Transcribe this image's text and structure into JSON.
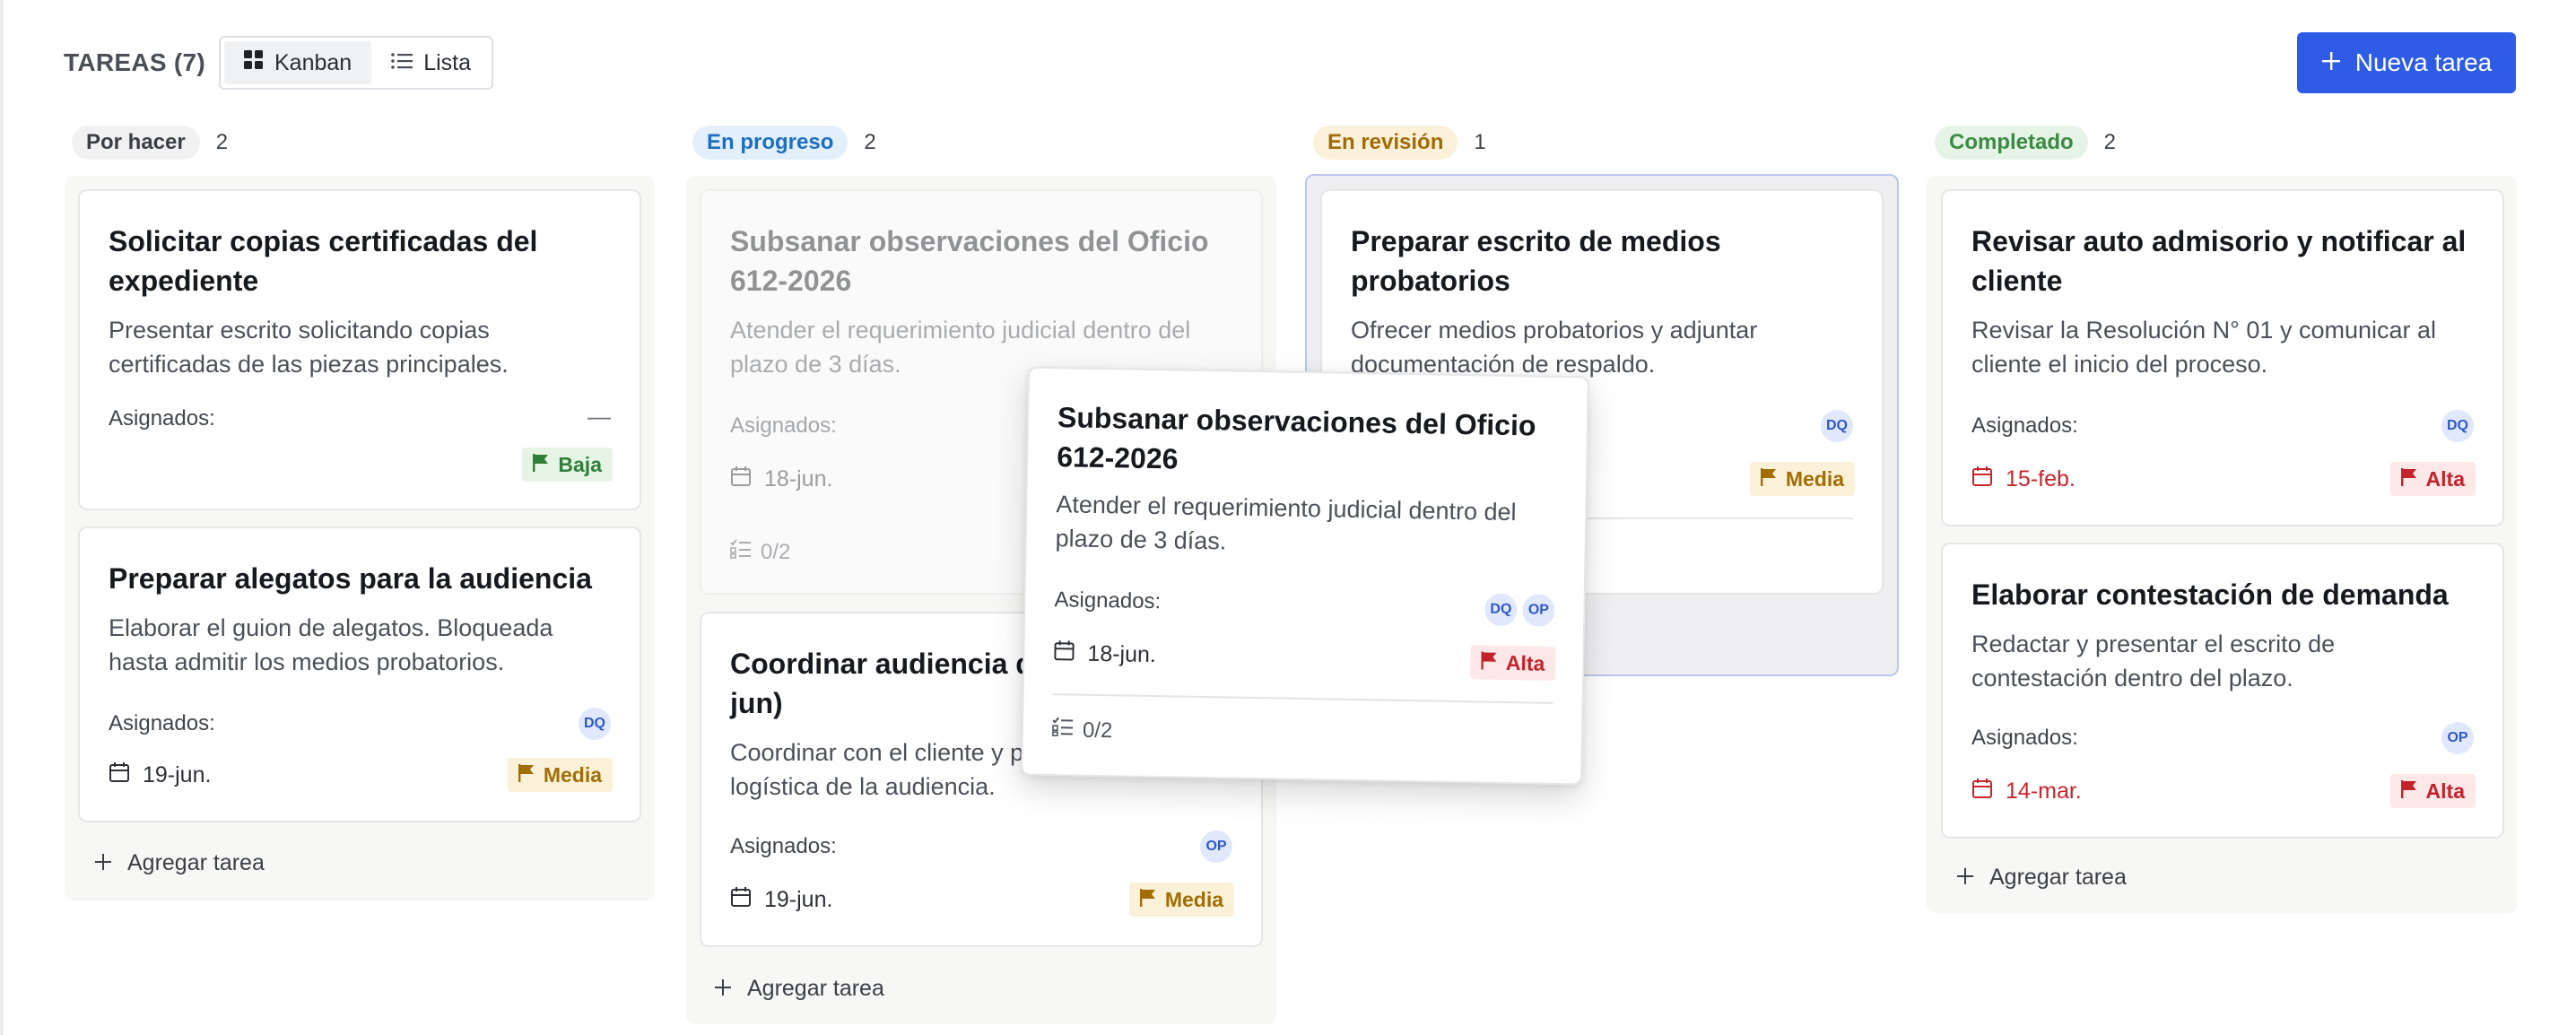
{
  "header": {
    "title": "TAREAS (7)",
    "views": [
      {
        "label": "Kanban",
        "icon": "grid-icon",
        "active": true
      },
      {
        "label": "Lista",
        "icon": "list-icon",
        "active": false
      }
    ],
    "new_task_label": "Nueva tarea"
  },
  "columns": [
    {
      "name": "Por hacer",
      "count": "2",
      "add_label": "Agregar tarea",
      "cards": [
        {
          "title": "Solicitar copias certificadas del expediente",
          "desc": "Presentar escrito solicitando copias certificadas de las piezas principales.",
          "assigned_label": "Asignados:",
          "assignee_placeholder": "—",
          "priority": "Baja"
        },
        {
          "title": "Preparar alegatos para la audiencia",
          "desc": "Elaborar el guion de alegatos. Bloqueada hasta admitir los medios probatorios.",
          "assigned_label": "Asignados:",
          "assignees": [
            "DQ"
          ],
          "date": "19-jun.",
          "priority": "Media"
        }
      ]
    },
    {
      "name": "En progreso",
      "count": "2",
      "add_label": "Agregar tarea",
      "cards": [
        {
          "title": "Subsanar observaciones del Oficio 612-2026",
          "desc": "Atender el requerimiento judicial dentro del plazo de 3 días.",
          "assigned_label": "Asignados:",
          "date": "18-jun.",
          "checklist": "0/2"
        },
        {
          "title": "Coordinar audiencia de",
          "title_line2": "jun)",
          "desc_line1": "Coordinar con el cliente y p",
          "desc_line2": "logística de la audiencia.",
          "assigned_label": "Asignados:",
          "assignees": [
            "OP"
          ],
          "date": "19-jun.",
          "priority": "Media"
        }
      ]
    },
    {
      "name": "En revisión",
      "count": "1",
      "cards": [
        {
          "title": "Preparar escrito de medios probatorios",
          "desc": "Ofrecer medios probatorios y adjuntar documentación de respaldo.",
          "assignees": [
            "DQ"
          ],
          "priority": "Media"
        }
      ]
    },
    {
      "name": "Completado",
      "count": "2",
      "add_label": "Agregar tarea",
      "cards": [
        {
          "title": "Revisar auto admisorio y notificar al cliente",
          "desc": "Revisar la Resolución N° 01 y comunicar al cliente el inicio del proceso.",
          "assigned_label": "Asignados:",
          "assignees": [
            "DQ"
          ],
          "date": "15-feb.",
          "priority": "Alta"
        },
        {
          "title": "Elaborar contestación de demanda",
          "desc": "Redactar y presentar el escrito de contestación dentro del plazo.",
          "assigned_label": "Asignados:",
          "assignees": [
            "OP"
          ],
          "date": "14-mar.",
          "priority": "Alta"
        }
      ]
    }
  ],
  "dragging_card": {
    "title": "Subsanar observaciones del Oficio 612-2026",
    "desc": "Atender el requerimiento judicial dentro del plazo de 3 días.",
    "assigned_label": "Asignados:",
    "assignees": [
      "DQ",
      "OP"
    ],
    "date": "18-jun.",
    "priority": "Alta",
    "checklist": "0/2"
  },
  "colors": {
    "accent": "#2f5ce6",
    "priority_low": "#2f7f39",
    "priority_medium": "#a36d06",
    "priority_high": "#c4222a"
  }
}
